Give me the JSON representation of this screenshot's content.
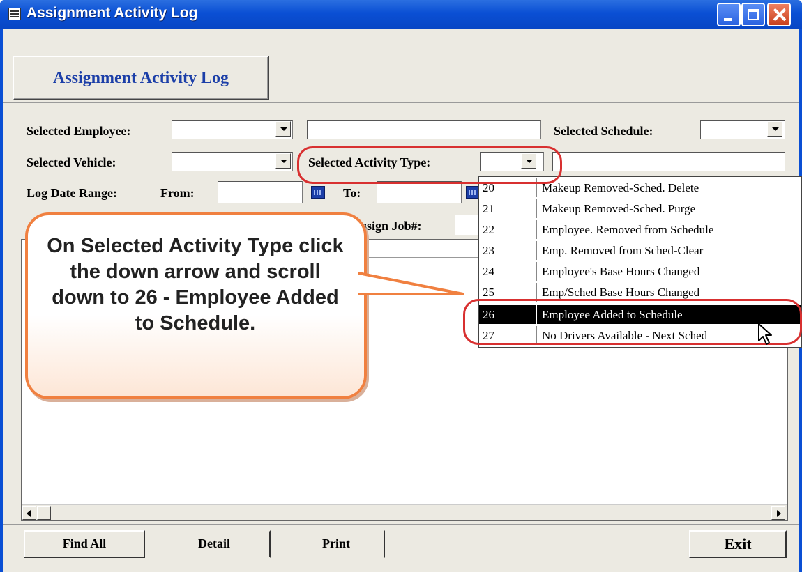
{
  "window": {
    "title": "Assignment Activity Log"
  },
  "header": {
    "button_label": "Assignment Activity Log"
  },
  "filters": {
    "employee_label": "Selected Employee:",
    "schedule_label": "Selected Schedule:",
    "vehicle_label": "Selected Vehicle:",
    "activity_type_label": "Selected Activity Type:",
    "date_range_label": "Log Date Range:",
    "from_label": "From:",
    "to_label": "To:",
    "assign_job_label": "Assign Job#:"
  },
  "activity_list": [
    {
      "code": "20",
      "label": "Makeup Removed-Sched. Delete"
    },
    {
      "code": "21",
      "label": "Makeup Removed-Sched. Purge"
    },
    {
      "code": "22",
      "label": "Employee. Removed from Schedule"
    },
    {
      "code": "23",
      "label": "Emp. Removed from Sched-Clear"
    },
    {
      "code": "24",
      "label": "Employee's Base Hours Changed"
    },
    {
      "code": "25",
      "label": "Emp/Sched Base Hours Changed"
    },
    {
      "code": "26",
      "label": "Employee Added to Schedule"
    },
    {
      "code": "27",
      "label": "No Drivers Available - Next Sched"
    }
  ],
  "callout": {
    "text": "On Selected Activity Type click the down arrow and scroll down to 26 - Employee Added to Schedule."
  },
  "footer": {
    "find_all": "Find All",
    "detail": "Detail",
    "print": "Print",
    "exit": "Exit"
  },
  "colors": {
    "accent": "#f08040",
    "highlight": "#d83030",
    "titlebar": "#0a4fd4"
  },
  "icons": [
    "window-icon",
    "minimize-icon",
    "maximize-icon",
    "close-icon",
    "calendar-icon",
    "mouse-cursor-icon"
  ]
}
